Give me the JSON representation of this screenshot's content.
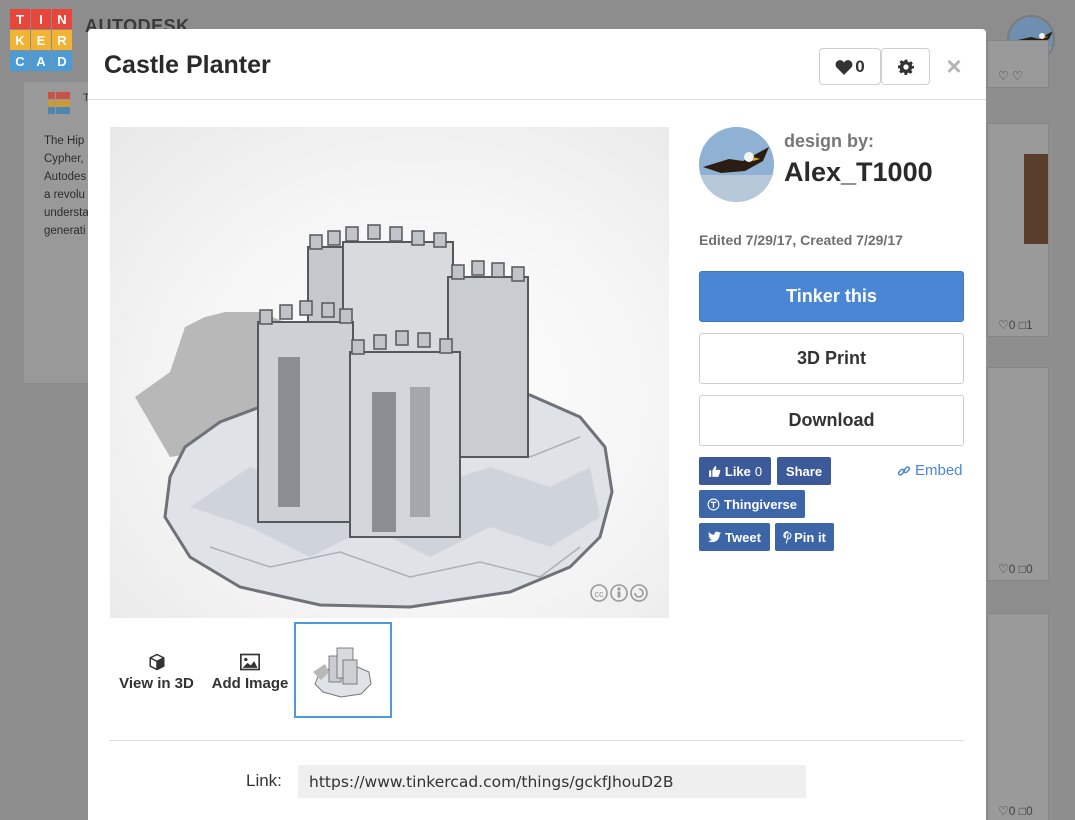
{
  "background": {
    "brand": "AUTODESK",
    "logo_letters": [
      "T",
      "I",
      "N",
      "K",
      "E",
      "R",
      "C",
      "A",
      "D"
    ],
    "logo_colors": [
      "#e8463a",
      "#e8463a",
      "#e8463a",
      "#f2b233",
      "#f2b233",
      "#f2b233",
      "#4a9bd6",
      "#4a9bd6",
      "#4a9bd6"
    ],
    "mini_logo_letter": "T",
    "article_text": "The Hip\nCypher,\nAutodes\na revolu\nundersta\ngenerati",
    "right_cards": [
      {
        "meta": "♡ ♡"
      },
      {
        "meta": "♡0 □1"
      },
      {
        "meta": "♡0 □0"
      },
      {
        "meta": "♡0 □0"
      }
    ]
  },
  "modal": {
    "title": "Castle Planter",
    "like_count": "0",
    "icons": {
      "like": "heart-icon",
      "settings": "gear-icon",
      "close": "close-icon"
    },
    "close_symbol": "×"
  },
  "tools": {
    "view3d_label": "View in 3D",
    "add_image_label": "Add Image"
  },
  "designer": {
    "design_by_label": "design by:",
    "name": "Alex_T1000",
    "edited": "Edited 7/29/17, Created 7/29/17"
  },
  "actions": {
    "tinker_label": "Tinker this",
    "print_label": "3D Print",
    "download_label": "Download"
  },
  "social": {
    "like_label": "Like",
    "like_count": "0",
    "share_label": "Share",
    "embed_label": "Embed",
    "thingiverse_label": "Thingiverse",
    "tweet_label": "Tweet",
    "pin_label": "Pin it"
  },
  "link": {
    "label": "Link:",
    "value": "https://www.tinkercad.com/things/gckfJhouD2B"
  },
  "colors": {
    "primary": "#4a86d4",
    "facebook": "#3c5a99",
    "selected_border": "#4e9ad6"
  }
}
